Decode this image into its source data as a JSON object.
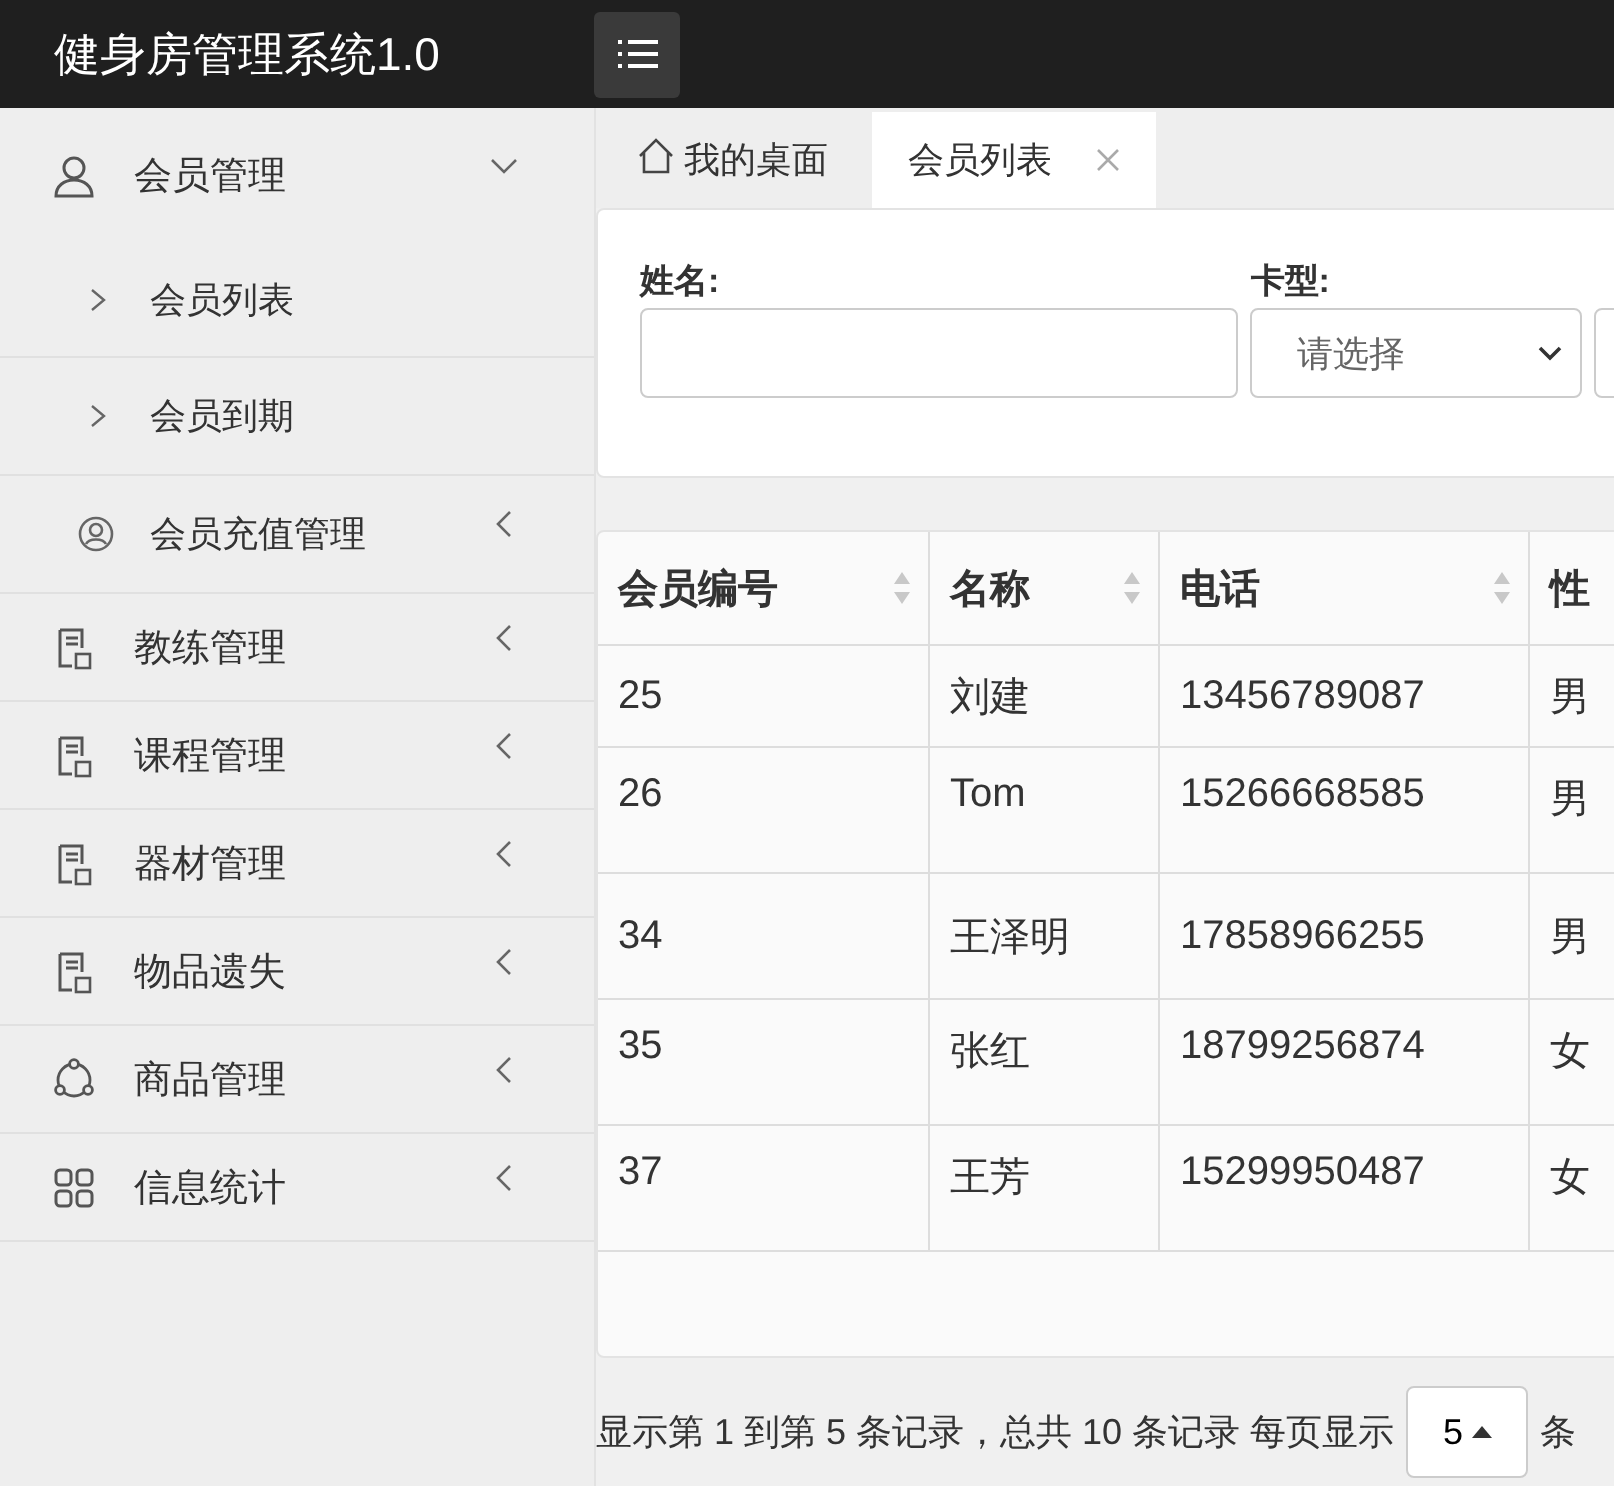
{
  "header": {
    "title": "健身房管理系统1.0"
  },
  "sidebar": {
    "items": [
      {
        "label": "会员管理",
        "expanded": true,
        "children": [
          {
            "label": "会员列表",
            "kind": "link"
          },
          {
            "label": "会员到期",
            "kind": "link"
          },
          {
            "label": "会员充值管理",
            "kind": "group",
            "expanded": false
          }
        ]
      },
      {
        "label": "教练管理",
        "expanded": false
      },
      {
        "label": "课程管理",
        "expanded": false
      },
      {
        "label": "器材管理",
        "expanded": false
      },
      {
        "label": "物品遗失",
        "expanded": false
      },
      {
        "label": "商品管理",
        "expanded": false
      },
      {
        "label": "信息统计",
        "expanded": false
      }
    ]
  },
  "tabs": [
    {
      "label": "我的桌面",
      "selected": false,
      "closable": false
    },
    {
      "label": "会员列表",
      "selected": true,
      "closable": true
    }
  ],
  "filters": [
    {
      "label": "姓名:",
      "kind": "text"
    },
    {
      "label": "卡型:",
      "kind": "select",
      "placeholder": "请选择"
    },
    {
      "kind": "text"
    }
  ],
  "table": {
    "columns": [
      {
        "label": "会员编号",
        "sortable": true
      },
      {
        "label": "名称",
        "sortable": true
      },
      {
        "label": "电话",
        "sortable": true
      },
      {
        "label": "性"
      }
    ],
    "rows": [
      [
        "25",
        "刘建",
        "13456789087",
        "男"
      ],
      [
        "26",
        "Tom",
        "15266668585",
        "男"
      ],
      [
        "34",
        "王泽明",
        "17858966255",
        "男"
      ],
      [
        "35",
        "张红",
        "18799256874",
        "女"
      ],
      [
        "37",
        "王芳",
        "15299950487",
        "女"
      ]
    ]
  },
  "pagination": {
    "summary": "显示第 1 到第 5 条记录，总共 10 条记录 每页显示",
    "page_size": "5",
    "suffix": "条"
  }
}
